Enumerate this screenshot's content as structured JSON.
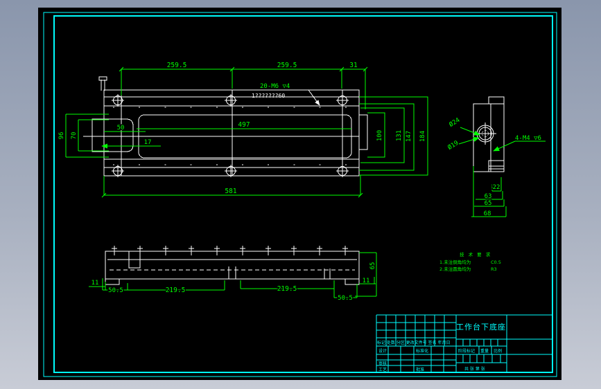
{
  "top_view": {
    "dim_259_left": "259.5",
    "dim_259_right": "259.5",
    "dim_31": "31",
    "thread_callout": "20-M6 ▽4",
    "thread_callout_sub": "1???????60",
    "dim_497": "497",
    "dim_581": "581",
    "dim_50": "50",
    "dim_17": "17",
    "dim_96": "96",
    "dim_70": "70",
    "dim_100": "100",
    "dim_131": "131",
    "dim_147": "147",
    "dim_184": "184"
  },
  "side_view": {
    "dia_24": "Ø24",
    "dia_19": "Ø19",
    "thread_callout": "4-M4 ▽6",
    "dim_22": "22",
    "dim_63": "63",
    "dim_65": "65",
    "dim_68": "68"
  },
  "front_view": {
    "dim_11_left": "11",
    "dim_50_5_left": "50.5",
    "dim_219_left": "219.5",
    "dim_219_right": "219.5",
    "dim_50_5_right": "50.5",
    "dim_11_right": "11",
    "dim_65": "65"
  },
  "tech_notes": {
    "title": "技 术 要 求",
    "line1": "1.未注倒角均为",
    "value1": "C0.5",
    "line2": "2.未注圆角均为",
    "value2": "R3"
  },
  "title_block": {
    "part_title": "工作台下底座",
    "revision_header": "标记 处数 分区 更改文件号 签名 年月日",
    "design_label": "设计",
    "standard_label": "标准化",
    "check_label": "审核",
    "process_label": "工艺",
    "approve_label": "批准",
    "stage_label": "阶段标记",
    "weight_label": "重量",
    "scale_label": "比例",
    "sheet_label": "共  张  第  张"
  },
  "colors": {
    "geometry": "#ffffff",
    "dimension": "#00ff00",
    "frame": "#00ffff",
    "paper": "#000000"
  }
}
